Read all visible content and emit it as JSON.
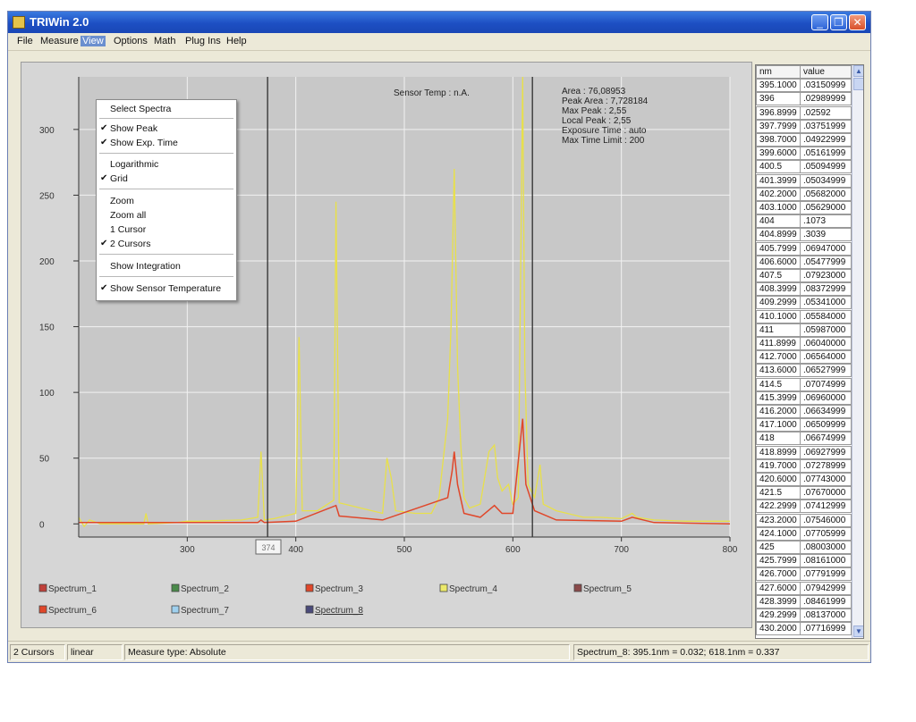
{
  "window": {
    "title": "TRIWin 2.0",
    "controls": {
      "minimize": "_",
      "maximize": "❐",
      "close": "✕"
    }
  },
  "menubar": {
    "items": [
      "File",
      "Measure",
      "View",
      "Options",
      "Math",
      "Plug Ins",
      "Help"
    ],
    "active": "View"
  },
  "view_menu": {
    "items": [
      {
        "label": "Select Spectra",
        "checked": false
      },
      {
        "label": "Show Peak",
        "checked": true
      },
      {
        "label": "Show Exp. Time",
        "checked": true
      },
      {
        "label": "Logarithmic",
        "checked": false
      },
      {
        "label": "Grid",
        "checked": true
      },
      {
        "label": "Zoom",
        "checked": false
      },
      {
        "label": "Zoom all",
        "checked": false
      },
      {
        "label": "1 Cursor",
        "checked": false
      },
      {
        "label": "2 Cursors",
        "checked": true
      },
      {
        "label": "Show Integration",
        "checked": false
      },
      {
        "label": "Show Sensor Temperature",
        "checked": true
      }
    ],
    "check_glyph": "✔"
  },
  "plot": {
    "sensor_temp": "Sensor Temp : n.A.",
    "info_lines": [
      "Area : 76,08953",
      "Peak Area : 7,728184",
      "Max Peak : 2,55",
      "Local Peak : 2,55",
      "Exposure Time : auto",
      "Max Time Limit : 200"
    ],
    "cursor_readout": "374",
    "colors": {
      "yellow": "#e8e04a",
      "red": "#e0472a",
      "grid": "#f2f2f2",
      "plot_bg": "#c8c8c8"
    }
  },
  "chart_data": {
    "type": "line",
    "title": "",
    "xlabel": "",
    "ylabel": "",
    "xlim": [
      200,
      800
    ],
    "ylim": [
      -10,
      340
    ],
    "x_ticks": [
      300,
      400,
      500,
      600,
      700,
      800
    ],
    "y_ticks": [
      0,
      50,
      100,
      150,
      200,
      250,
      300
    ],
    "cursors_x": [
      374,
      618
    ],
    "grid": true,
    "series": [
      {
        "name": "Spectrum_4",
        "color": "#e8e04a",
        "points": [
          [
            200,
            5
          ],
          [
            205,
            -2
          ],
          [
            210,
            3
          ],
          [
            220,
            0
          ],
          [
            250,
            0
          ],
          [
            260,
            0
          ],
          [
            262,
            8
          ],
          [
            264,
            0
          ],
          [
            290,
            1
          ],
          [
            300,
            2
          ],
          [
            310,
            2
          ],
          [
            350,
            3
          ],
          [
            365,
            5
          ],
          [
            368,
            55
          ],
          [
            371,
            3
          ],
          [
            380,
            4
          ],
          [
            400,
            8
          ],
          [
            403,
            142
          ],
          [
            406,
            10
          ],
          [
            420,
            10
          ],
          [
            435,
            18
          ],
          [
            437,
            245
          ],
          [
            440,
            16
          ],
          [
            460,
            12
          ],
          [
            480,
            8
          ],
          [
            484,
            50
          ],
          [
            488,
            35
          ],
          [
            492,
            10
          ],
          [
            510,
            8
          ],
          [
            525,
            8
          ],
          [
            532,
            20
          ],
          [
            540,
            80
          ],
          [
            543,
            150
          ],
          [
            546,
            270
          ],
          [
            549,
            120
          ],
          [
            552,
            60
          ],
          [
            555,
            20
          ],
          [
            560,
            12
          ],
          [
            570,
            15
          ],
          [
            578,
            55
          ],
          [
            583,
            60
          ],
          [
            586,
            35
          ],
          [
            590,
            25
          ],
          [
            596,
            30
          ],
          [
            600,
            15
          ],
          [
            605,
            20
          ],
          [
            609,
            340
          ],
          [
            611,
            120
          ],
          [
            614,
            30
          ],
          [
            620,
            20
          ],
          [
            625,
            45
          ],
          [
            628,
            15
          ],
          [
            640,
            10
          ],
          [
            650,
            8
          ],
          [
            665,
            5
          ],
          [
            680,
            5
          ],
          [
            700,
            4
          ],
          [
            710,
            8
          ],
          [
            714,
            5
          ],
          [
            730,
            3
          ],
          [
            760,
            2
          ],
          [
            800,
            2
          ]
        ]
      },
      {
        "name": "Spectrum_3",
        "color": "#e0472a",
        "points": [
          [
            200,
            1
          ],
          [
            300,
            1
          ],
          [
            365,
            1
          ],
          [
            368,
            3
          ],
          [
            371,
            1
          ],
          [
            400,
            2
          ],
          [
            437,
            14
          ],
          [
            440,
            6
          ],
          [
            480,
            3
          ],
          [
            540,
            20
          ],
          [
            544,
            40
          ],
          [
            546,
            55
          ],
          [
            549,
            30
          ],
          [
            555,
            8
          ],
          [
            570,
            5
          ],
          [
            583,
            14
          ],
          [
            590,
            8
          ],
          [
            600,
            8
          ],
          [
            609,
            80
          ],
          [
            612,
            30
          ],
          [
            620,
            10
          ],
          [
            640,
            3
          ],
          [
            700,
            2
          ],
          [
            710,
            5
          ],
          [
            730,
            1
          ],
          [
            800,
            0
          ]
        ]
      }
    ],
    "legend": [
      "Spectrum_1",
      "Spectrum_2",
      "Spectrum_3",
      "Spectrum_4",
      "Spectrum_5",
      "Spectrum_6",
      "Spectrum_7",
      "Spectrum_8"
    ],
    "legend_colors": [
      "#c0403a",
      "#4a8a4a",
      "#e0472a",
      "#ece96a",
      "#8a4a4a",
      "#e0472a",
      "#9fd0ee",
      "#4a4a7a"
    ],
    "legend_placement": "bottom"
  },
  "table": {
    "headers": [
      "nm",
      "value"
    ],
    "rows": [
      [
        "395.1000",
        ".03150999"
      ],
      [
        "396",
        ".02989999"
      ],
      [
        "396.8999",
        ".02592"
      ],
      [
        "397.7999",
        ".03751999"
      ],
      [
        "398.7000",
        ".04922999"
      ],
      [
        "399.6000",
        ".05161999"
      ],
      [
        "400.5",
        ".05094999"
      ],
      [
        "401.3999",
        ".05034999"
      ],
      [
        "402.2000",
        ".05682000"
      ],
      [
        "403.1000",
        ".05629000"
      ],
      [
        "404",
        ".1073"
      ],
      [
        "404.8999",
        ".3039"
      ],
      [
        "405.7999",
        ".06947000"
      ],
      [
        "406.6000",
        ".05477999"
      ],
      [
        "407.5",
        ".07923000"
      ],
      [
        "408.3999",
        ".08372999"
      ],
      [
        "409.2999",
        ".05341000"
      ],
      [
        "410.1000",
        ".05584000"
      ],
      [
        "411",
        ".05987000"
      ],
      [
        "411.8999",
        ".06040000"
      ],
      [
        "412.7000",
        ".06564000"
      ],
      [
        "413.6000",
        ".06527999"
      ],
      [
        "414.5",
        ".07074999"
      ],
      [
        "415.3999",
        ".06960000"
      ],
      [
        "416.2000",
        ".06634999"
      ],
      [
        "417.1000",
        ".06509999"
      ],
      [
        "418",
        ".06674999"
      ],
      [
        "418.8999",
        ".06927999"
      ],
      [
        "419.7000",
        ".07278999"
      ],
      [
        "420.6000",
        ".07743000"
      ],
      [
        "421.5",
        ".07670000"
      ],
      [
        "422.2999",
        ".07412999"
      ],
      [
        "423.2000",
        ".07546000"
      ],
      [
        "424.1000",
        ".07705999"
      ],
      [
        "425",
        ".08003000"
      ],
      [
        "425.7999",
        ".08161000"
      ],
      [
        "426.7000",
        ".07791999"
      ],
      [
        "427.6000",
        ".07942999"
      ],
      [
        "428.3999",
        ".08461999"
      ],
      [
        "429.2999",
        ".08137000"
      ],
      [
        "430.2000",
        ".07716999"
      ]
    ]
  },
  "status": {
    "cursor_mode": "2 Cursors",
    "scale": "linear",
    "measure_type": "Measure type: Absolute",
    "empty": "",
    "readout": "Spectrum_8: 395.1nm = 0.032; 618.1nm = 0.337"
  }
}
